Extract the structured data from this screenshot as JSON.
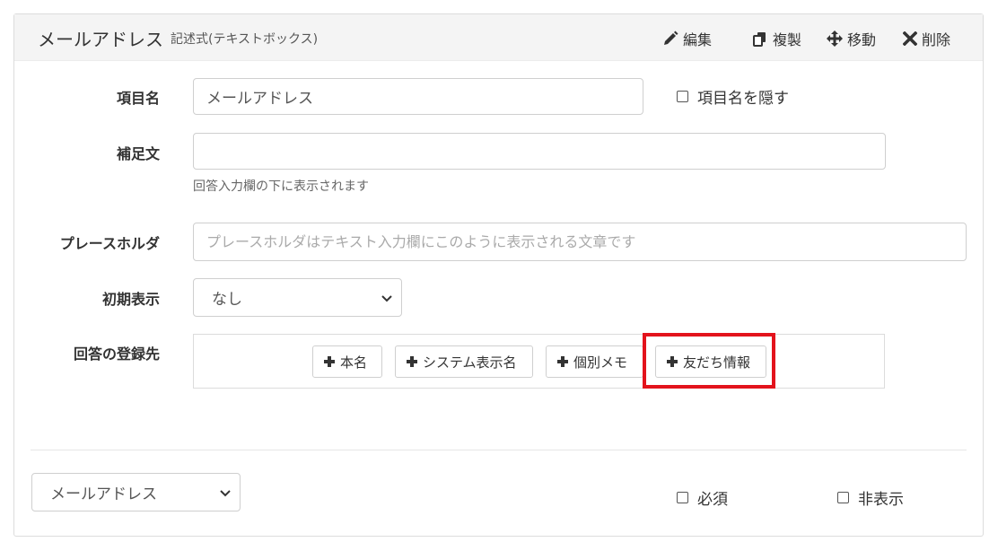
{
  "header": {
    "title": "メールアドレス",
    "subtitle": "記述式(テキストボックス)",
    "actions": {
      "edit": "編集",
      "duplicate": "複製",
      "move": "移動",
      "delete": "削除"
    }
  },
  "form": {
    "item_name": {
      "label": "項目名",
      "value": "メールアドレス",
      "hide_label": "項目名を隠す"
    },
    "supplement": {
      "label": "補足文",
      "value": "",
      "help": "回答入力欄の下に表示されます"
    },
    "placeholder": {
      "label": "プレースホルダ",
      "placeholder": "プレースホルダはテキスト入力欄にこのように表示される文章です"
    },
    "initial_display": {
      "label": "初期表示",
      "selected": "なし"
    },
    "destination": {
      "label": "回答の登録先",
      "buttons": {
        "real_name": "本名",
        "system_name": "システム表示名",
        "memo": "個別メモ",
        "friend_info": "友だち情報"
      }
    }
  },
  "footer": {
    "type_select": "メールアドレス",
    "required_label": "必須",
    "hidden_label": "非表示"
  },
  "colors": {
    "highlight": "#e3131c",
    "header_bg": "#f4f4f4"
  }
}
